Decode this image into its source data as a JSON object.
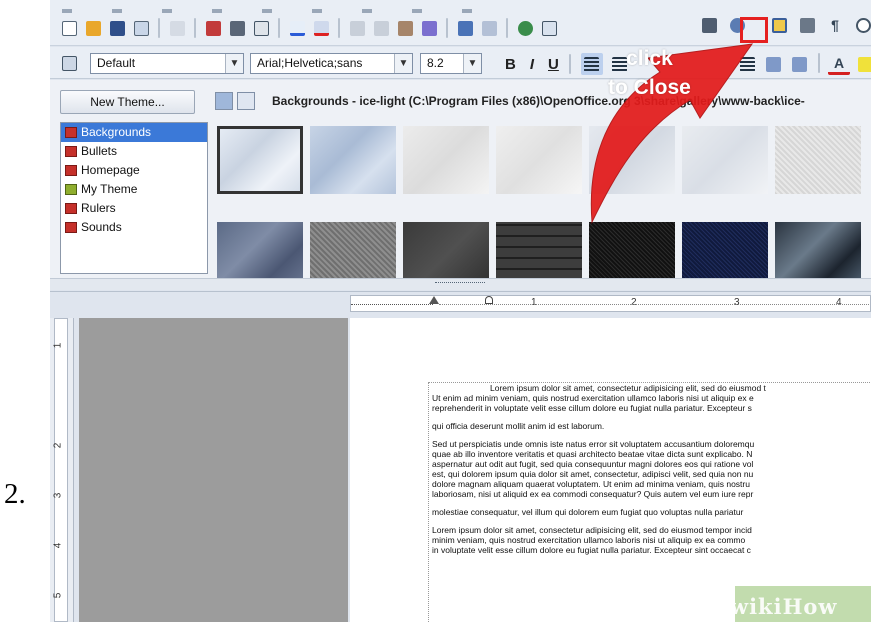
{
  "step_number": "2.",
  "formatting_bar": {
    "paragraph_style": "Default",
    "font_name": "Arial;Helvetica;sans",
    "font_size": "8.2",
    "bold": "B",
    "italic": "I",
    "underline": "U"
  },
  "gallery": {
    "new_theme_button": "New Theme...",
    "path_label": "Backgrounds - ice-light (C:\\Program Files (x86)\\OpenOffice.org 3\\share\\gallery\\www-back\\ice-",
    "themes": [
      {
        "label": "Backgrounds",
        "active": true,
        "color": "red"
      },
      {
        "label": "Bullets",
        "active": false,
        "color": "red"
      },
      {
        "label": "Homepage",
        "active": false,
        "color": "red"
      },
      {
        "label": "My Theme",
        "active": false,
        "color": "green"
      },
      {
        "label": "Rulers",
        "active": false,
        "color": "red"
      },
      {
        "label": "Sounds",
        "active": false,
        "color": "red"
      }
    ],
    "tiles_row1": [
      "ice-light",
      "ice-blue",
      "paper-white",
      "marble-light",
      "snow",
      "frost",
      "texture-grey"
    ],
    "tiles_row2": [
      "stone-blue",
      "granite-grey",
      "slate-dark",
      "brick-dark",
      "black-speckle",
      "navy-speckle",
      "marble-dark"
    ]
  },
  "ruler": {
    "h_marks": [
      "1",
      "2",
      "3",
      "4"
    ],
    "v_marks": [
      "1",
      "2",
      "3",
      "4",
      "5"
    ]
  },
  "callout": {
    "line1": "click",
    "line2": "to Close",
    "arrow_color": "#e31b1b"
  },
  "document": {
    "paragraphs": [
      "Lorem ipsum dolor sit amet, consectetur adipisicing elit, sed do eiusmod t",
      "Ut enim ad minim veniam, quis nostrud exercitation ullamco laboris nisi ut aliquip ex e",
      "reprehenderit in voluptate velit esse cillum dolore eu fugiat nulla pariatur. Excepteur s",
      "qui officia deserunt mollit anim id est laborum.",
      "Sed ut perspiciatis unde omnis iste natus error sit voluptatem accusantium doloremqu",
      "quae ab illo inventore veritatis et quasi architecto beatae vitae dicta sunt explicabo. N",
      "aspernatur aut odit aut fugit, sed quia consequuntur magni dolores eos qui ratione vol",
      "est, qui dolorem ipsum quia dolor sit amet, consectetur, adipisci velit, sed quia non nu",
      "dolore magnam aliquam quaerat voluptatem. Ut enim ad minima veniam, quis nostru",
      "laboriosam, nisi ut aliquid ex ea commodi consequatur? Quis autem vel eum iure repr",
      "molestiae consequatur, vel illum qui dolorem eum fugiat quo voluptas nulla pariatur",
      "Lorem ipsum dolor sit amet, consectetur adipisicing elit, sed do eiusmod tempor incid",
      "minim veniam, quis nostrud exercitation ullamco laboris nisi ut aliquip ex ea commo",
      "in voluptate velit esse cillum dolore eu fugiat nulla pariatur. Excepteur sint occaecat c"
    ]
  },
  "watermark": "wikiHow"
}
